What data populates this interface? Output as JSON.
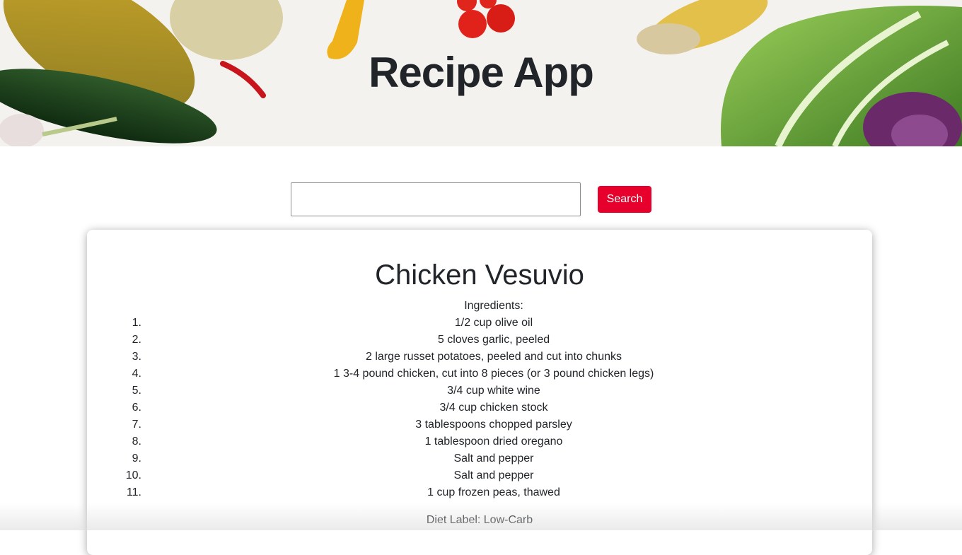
{
  "header": {
    "title": "Recipe App"
  },
  "search": {
    "value": "",
    "placeholder": "",
    "button_label": "Search"
  },
  "recipe": {
    "title": "Chicken Vesuvio",
    "ingredients_label": "Ingredients:",
    "ingredients": [
      {
        "num": "1.",
        "text": "1/2 cup olive oil"
      },
      {
        "num": "2.",
        "text": "5 cloves garlic, peeled"
      },
      {
        "num": "3.",
        "text": "2 large russet potatoes, peeled and cut into chunks"
      },
      {
        "num": "4.",
        "text": "1 3-4 pound chicken, cut into 8 pieces (or 3 pound chicken legs)"
      },
      {
        "num": "5.",
        "text": "3/4 cup white wine"
      },
      {
        "num": "6.",
        "text": "3/4 cup chicken stock"
      },
      {
        "num": "7.",
        "text": "3 tablespoons chopped parsley"
      },
      {
        "num": "8.",
        "text": "1 tablespoon dried oregano"
      },
      {
        "num": "9.",
        "text": "Salt and pepper"
      },
      {
        "num": "10.",
        "text": "Salt and pepper"
      },
      {
        "num": "11.",
        "text": "1 cup frozen peas, thawed"
      }
    ],
    "diet_label": "Diet Label: Low-Carb"
  },
  "colors": {
    "accent": "#e8002c",
    "text": "#212529",
    "card_bg": "#ffffff"
  },
  "icons": {
    "hero": "vegetables-banner-image"
  }
}
